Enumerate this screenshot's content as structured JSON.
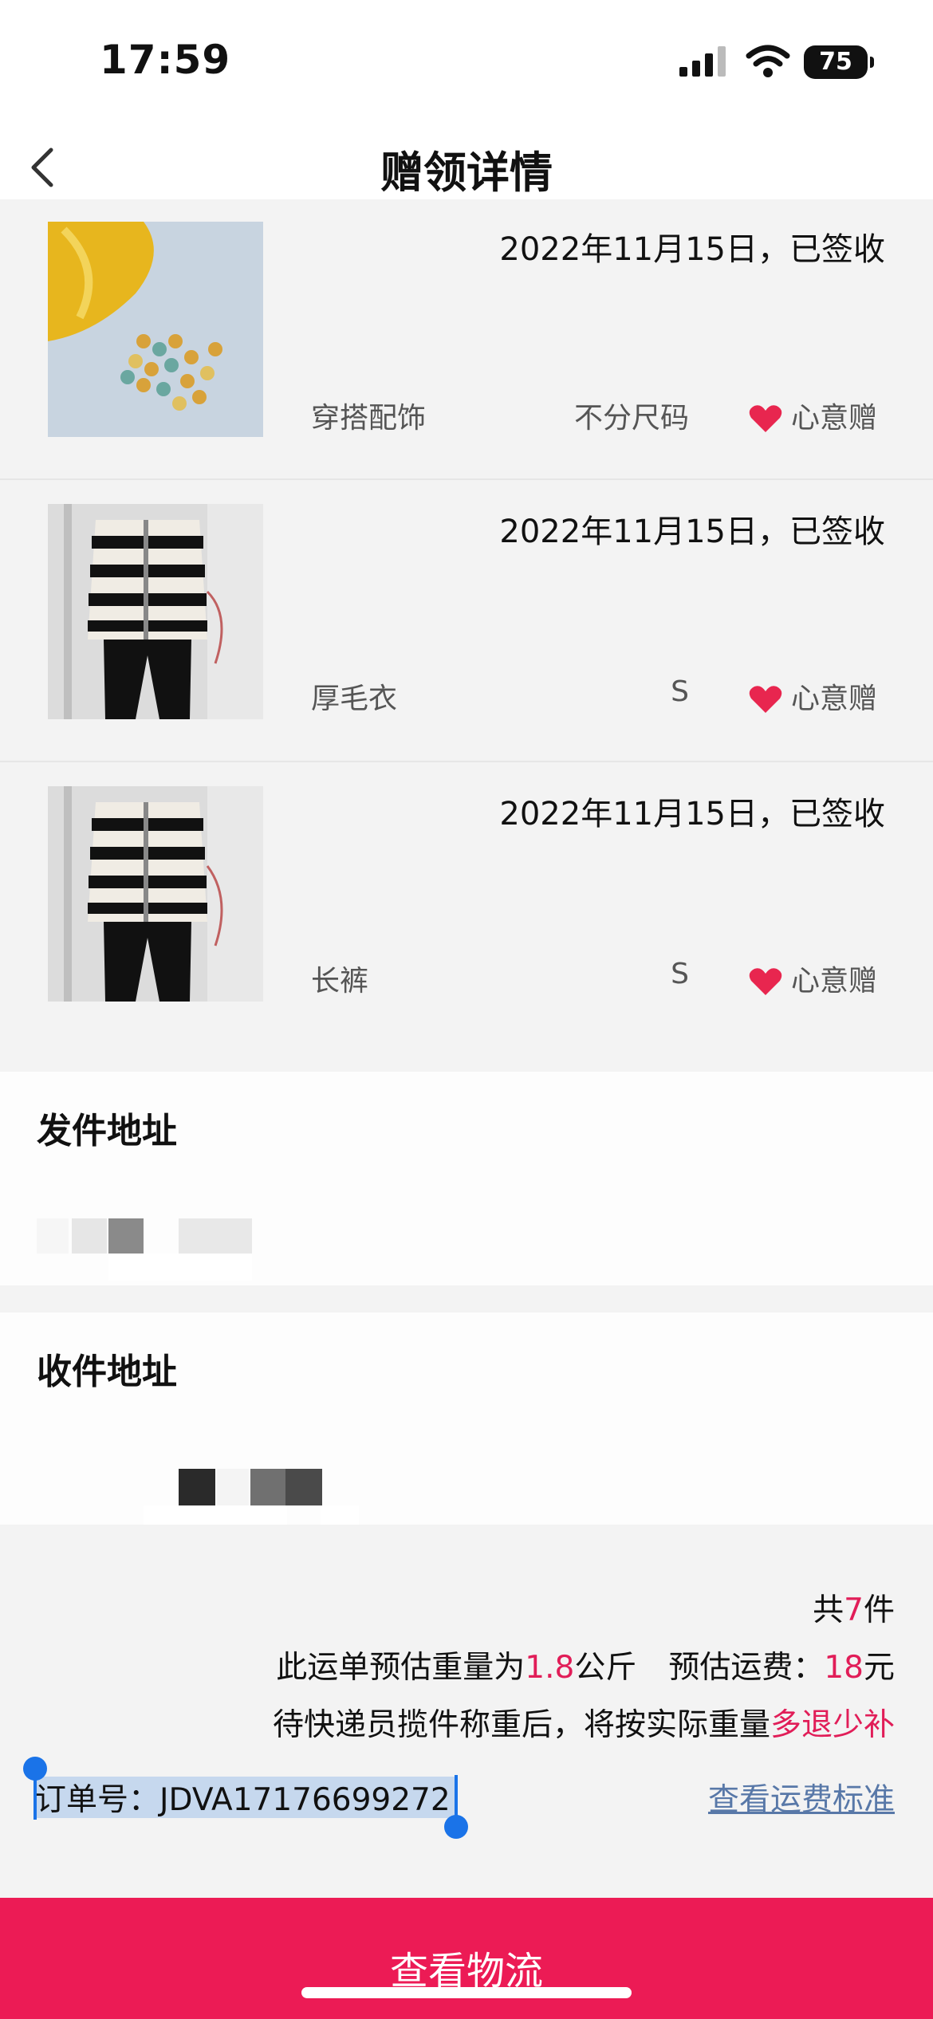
{
  "status": {
    "time": "17:59",
    "battery": "75"
  },
  "nav": {
    "title": "赠领详情"
  },
  "items": [
    {
      "date": "2022年11月15日，已签收",
      "category": "穿搭配饰",
      "size": "不分尺码",
      "tag": "心意赠"
    },
    {
      "date": "2022年11月15日，已签收",
      "category": "厚毛衣",
      "size": "S",
      "tag": "心意赠"
    },
    {
      "date": "2022年11月15日，已签收",
      "category": "长裤",
      "size": "S",
      "tag": "心意赠"
    }
  ],
  "sender": {
    "title": "发件地址"
  },
  "receiver": {
    "title": "收件地址"
  },
  "summary": {
    "count_prefix": "共",
    "count": "7",
    "count_suffix": "件",
    "weight_prefix": "此运单预估重量为",
    "weight": "1.8",
    "weight_suffix": "公斤",
    "fee_prefix": "预估运费：",
    "fee": "18",
    "fee_suffix": "元",
    "note_prefix": "待快递员揽件称重后，将按实际重量",
    "note_highlight": "多退少补"
  },
  "order": {
    "label": "订单号：JDVA17176699272",
    "freight_link": "查看运费标准"
  },
  "bottom_button": "查看物流",
  "colors": {
    "accent": "#ec1b55",
    "highlight": "#e11d58",
    "link": "#5878a8"
  }
}
